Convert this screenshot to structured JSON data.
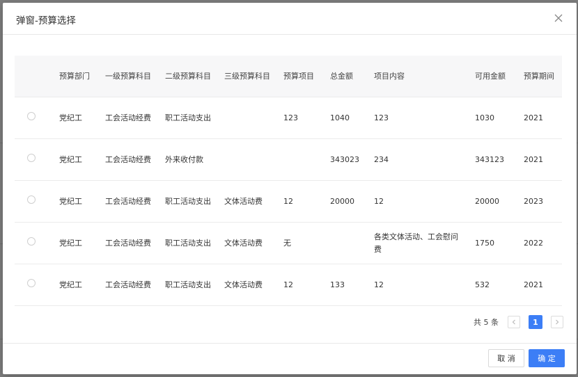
{
  "dialog": {
    "title": "弹窗-预算选择",
    "close_icon": "close-icon"
  },
  "table": {
    "columns": [
      "",
      "预算部门",
      "一级预算科目",
      "二级预算科目",
      "三级预算科目",
      "预算项目",
      "总金额",
      "项目内容",
      "可用金额",
      "预算期间"
    ],
    "rows": [
      {
        "dept": "党纪工",
        "level1": "工会活动经费",
        "level2": "职工活动支出",
        "level3": "",
        "item": "123",
        "total": "1040",
        "content": "123",
        "available": "1030",
        "period": "2021"
      },
      {
        "dept": "党纪工",
        "level1": "工会活动经费",
        "level2": "外来收付款",
        "level3": "",
        "item": "",
        "total": "343023",
        "content": "234",
        "available": "343123",
        "period": "2021"
      },
      {
        "dept": "党纪工",
        "level1": "工会活动经费",
        "level2": "职工活动支出",
        "level3": "文体活动费",
        "item": "12",
        "total": "20000",
        "content": "12",
        "available": "20000",
        "period": "2023"
      },
      {
        "dept": "党纪工",
        "level1": "工会活动经费",
        "level2": "职工活动支出",
        "level3": "文体活动费",
        "item": "无",
        "total": "",
        "content": "各类文体活动、工会慰问费",
        "available": "1750",
        "period": "2022"
      },
      {
        "dept": "党纪工",
        "level1": "工会活动经费",
        "level2": "职工活动支出",
        "level3": "文体活动费",
        "item": "12",
        "total": "133",
        "content": "12",
        "available": "532",
        "period": "2021"
      }
    ]
  },
  "pagination": {
    "total_text": "共 5 条",
    "current_page": "1",
    "prev_icon": "chevron-left-icon",
    "next_icon": "chevron-right-icon"
  },
  "footer": {
    "cancel_label": "取 消",
    "ok_label": "确 定"
  },
  "colors": {
    "primary": "#3c7ef6",
    "header_bg": "#f7f7f8"
  }
}
